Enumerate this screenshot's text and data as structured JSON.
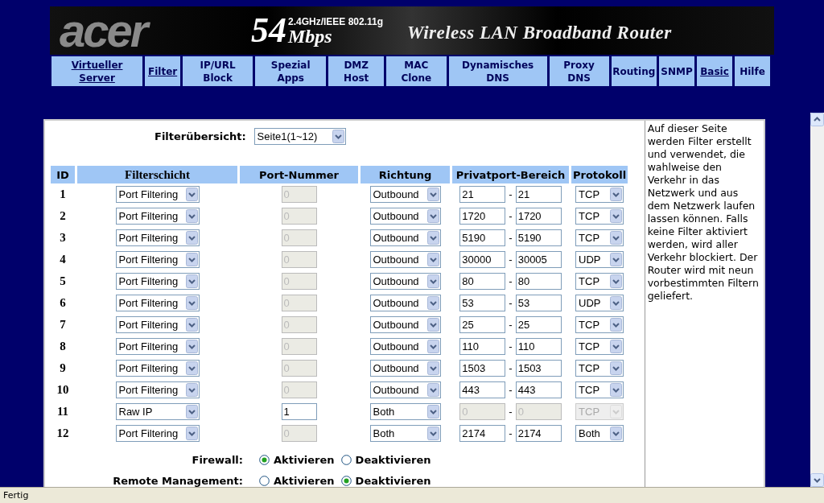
{
  "banner": {
    "logo": "acer",
    "speed": "54",
    "band": "2.4GHz/IEEE 802.11g",
    "unit": "Mbps",
    "product": "Wireless LAN Broadband Router"
  },
  "nav": {
    "left": [
      {
        "label": "Virtueller Server",
        "underlined": true
      },
      {
        "label": "Filter",
        "underlined": true
      },
      {
        "label": "IP/URL Block",
        "underlined": false
      },
      {
        "label": "Spezial Apps",
        "underlined": false
      },
      {
        "label": "DMZ Host",
        "underlined": false
      },
      {
        "label": "MAC Clone",
        "underlined": false
      },
      {
        "label": "Dynamisches DNS",
        "underlined": false
      },
      {
        "label": "Proxy DNS",
        "underlined": false
      },
      {
        "label": "Routing",
        "underlined": false
      },
      {
        "label": "SNMP",
        "underlined": false
      }
    ],
    "right": [
      {
        "label": "Basic",
        "underlined": true
      },
      {
        "label": "Hilfe",
        "underlined": false
      }
    ]
  },
  "overview": {
    "label": "Filterübersicht:",
    "value": "Seite1(1~12)"
  },
  "table": {
    "columns": [
      "ID",
      "Filterschicht",
      "Port-Nummer",
      "Richtung",
      "Privatport-Bereich",
      "Protokoll"
    ],
    "rows": [
      {
        "id": "1",
        "layer": "Port Filtering",
        "port": "0",
        "port_disabled": true,
        "direction": "Outbound",
        "from": "21",
        "to": "21",
        "range_disabled": false,
        "protocol": "TCP",
        "protocol_disabled": false
      },
      {
        "id": "2",
        "layer": "Port Filtering",
        "port": "0",
        "port_disabled": true,
        "direction": "Outbound",
        "from": "1720",
        "to": "1720",
        "range_disabled": false,
        "protocol": "TCP",
        "protocol_disabled": false
      },
      {
        "id": "3",
        "layer": "Port Filtering",
        "port": "0",
        "port_disabled": true,
        "direction": "Outbound",
        "from": "5190",
        "to": "5190",
        "range_disabled": false,
        "protocol": "TCP",
        "protocol_disabled": false
      },
      {
        "id": "4",
        "layer": "Port Filtering",
        "port": "0",
        "port_disabled": true,
        "direction": "Outbound",
        "from": "30000",
        "to": "30005",
        "range_disabled": false,
        "protocol": "UDP",
        "protocol_disabled": false
      },
      {
        "id": "5",
        "layer": "Port Filtering",
        "port": "0",
        "port_disabled": true,
        "direction": "Outbound",
        "from": "80",
        "to": "80",
        "range_disabled": false,
        "protocol": "TCP",
        "protocol_disabled": false
      },
      {
        "id": "6",
        "layer": "Port Filtering",
        "port": "0",
        "port_disabled": true,
        "direction": "Outbound",
        "from": "53",
        "to": "53",
        "range_disabled": false,
        "protocol": "UDP",
        "protocol_disabled": false
      },
      {
        "id": "7",
        "layer": "Port Filtering",
        "port": "0",
        "port_disabled": true,
        "direction": "Outbound",
        "from": "25",
        "to": "25",
        "range_disabled": false,
        "protocol": "TCP",
        "protocol_disabled": false
      },
      {
        "id": "8",
        "layer": "Port Filtering",
        "port": "0",
        "port_disabled": true,
        "direction": "Outbound",
        "from": "110",
        "to": "110",
        "range_disabled": false,
        "protocol": "TCP",
        "protocol_disabled": false
      },
      {
        "id": "9",
        "layer": "Port Filtering",
        "port": "0",
        "port_disabled": true,
        "direction": "Outbound",
        "from": "1503",
        "to": "1503",
        "range_disabled": false,
        "protocol": "TCP",
        "protocol_disabled": false
      },
      {
        "id": "10",
        "layer": "Port Filtering",
        "port": "0",
        "port_disabled": true,
        "direction": "Outbound",
        "from": "443",
        "to": "443",
        "range_disabled": false,
        "protocol": "TCP",
        "protocol_disabled": false
      },
      {
        "id": "11",
        "layer": "Raw IP",
        "port": "1",
        "port_disabled": false,
        "direction": "Both",
        "from": "0",
        "to": "0",
        "range_disabled": true,
        "protocol": "TCP",
        "protocol_disabled": true
      },
      {
        "id": "12",
        "layer": "Port Filtering",
        "port": "0",
        "port_disabled": true,
        "direction": "Both",
        "from": "2174",
        "to": "2174",
        "range_disabled": false,
        "protocol": "Both",
        "protocol_disabled": false
      }
    ]
  },
  "range_separator": "-",
  "options": [
    {
      "label": "Firewall:",
      "choices": [
        {
          "label": "Aktivieren",
          "selected": true
        },
        {
          "label": "Deaktivieren",
          "selected": false
        }
      ]
    },
    {
      "label": "Remote Management:",
      "choices": [
        {
          "label": "Aktivieren",
          "selected": false
        },
        {
          "label": "Deaktivieren",
          "selected": true
        }
      ]
    }
  ],
  "help": "Auf dieser Seite werden Filter erstellt und verwendet, die wahlweise den Verkehr in das Netzwerk und aus dem Netzwerk laufen lassen können. Falls keine Filter aktiviert werden, wird aller Verkehr blockiert. Der Router wird mit neun vorbestimmten Filtern geliefert.",
  "status_bar": "Fertig"
}
